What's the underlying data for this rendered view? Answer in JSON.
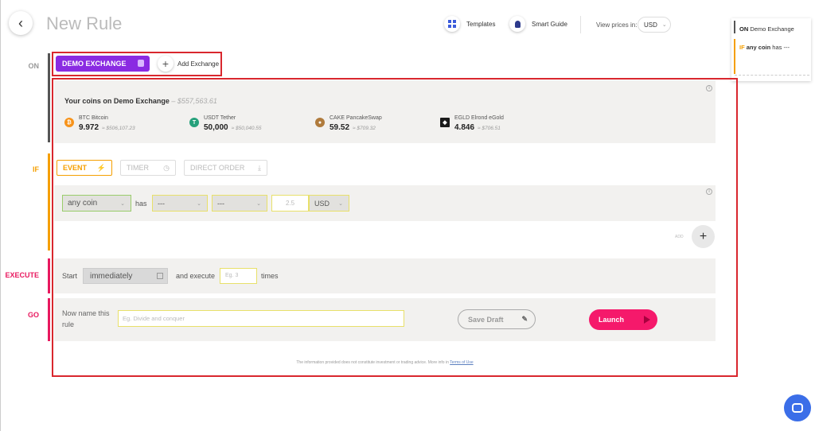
{
  "header": {
    "back_label": "‹",
    "title": "New Rule",
    "templates_label": "Templates",
    "smart_guide_label": "Smart Guide",
    "view_prices_label": "View prices in:",
    "currency": "USD"
  },
  "summary": {
    "on_keyword": "ON",
    "on_text": "Demo Exchange",
    "if_keyword": "IF",
    "if_coin": "any coin",
    "if_text": "has ---"
  },
  "sections": {
    "on": "ON",
    "if": "IF",
    "execute": "EXECUTE",
    "go": "GO"
  },
  "on": {
    "exchange_button": "DEMO EXCHANGE",
    "add_exchange": "Add Exchange",
    "plus": "+"
  },
  "coins": {
    "title": "Your coins on Demo Exchange",
    "total": "$557,563.61",
    "items": [
      {
        "icon": "₿",
        "name": "BTC Bitcoin",
        "amount": "9.972",
        "value": "$506,107.23",
        "color": "#f7931a"
      },
      {
        "icon": "T",
        "name": "USDT Tether",
        "amount": "50,000",
        "value": "$50,040.55",
        "color": "#26a17b"
      },
      {
        "icon": "●",
        "name": "CAKE PancakeSwap",
        "amount": "59.52",
        "value": "$709.32",
        "color": "#b07b3c"
      },
      {
        "icon": "◆",
        "name": "EGLD Elrond eGold",
        "amount": "4.846",
        "value": "$706.51",
        "color": "#1b1b1b"
      }
    ]
  },
  "if": {
    "tabs": [
      {
        "label": "EVENT",
        "icon": "⚡"
      },
      {
        "label": "TIMER",
        "icon": "◷"
      },
      {
        "label": "DIRECT ORDER",
        "icon": "⤓"
      }
    ],
    "coin_select": "any coin",
    "has": "has",
    "select_1": "---",
    "select_2": "---",
    "amount_placeholder": "2.5",
    "currency": "USD",
    "add_label": "ADD",
    "add_plus": "+"
  },
  "execute": {
    "start": "Start",
    "start_value": "immediately",
    "and_execute": "and execute",
    "times_placeholder": "Eg. 3",
    "times": "times"
  },
  "go": {
    "name_label": "Now name this rule",
    "name_placeholder": "Eg. Divide and conquer",
    "save_draft": "Save Draft",
    "launch": "Launch"
  },
  "footer": {
    "disclaimer": "The information provided does not constitute investment or trading advice. More info in",
    "terms": "Terms of Use"
  },
  "colors": {
    "accent_purple": "#8a2be2",
    "if_orange": "#f59f00",
    "execute_pink": "#e8195f",
    "launch_pink": "#f5196b",
    "highlight_red": "#d9272e"
  }
}
